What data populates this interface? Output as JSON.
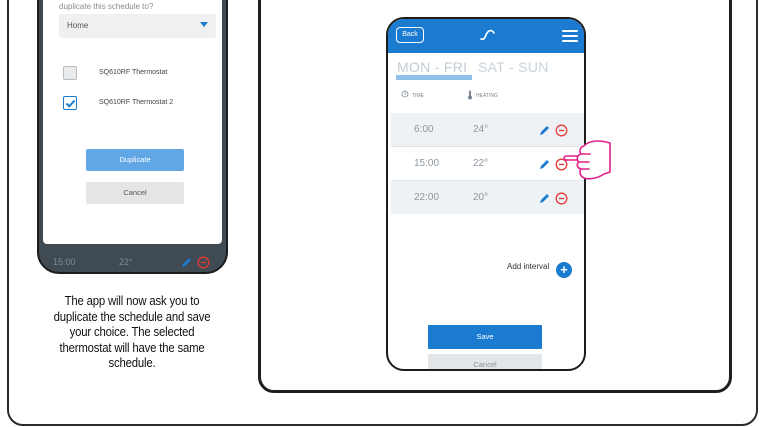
{
  "dialog": {
    "question": "duplicate this schedule to?",
    "select_value": "Home",
    "options": [
      {
        "label": "SQ610RF Thermostat",
        "checked": false
      },
      {
        "label": "SQ610RF Thermostat 2",
        "checked": true
      }
    ],
    "duplicate_label": "Duplicate",
    "cancel_label": "Cancel"
  },
  "left_phone_row": {
    "time": "15:00",
    "temp": "22°"
  },
  "caption": "The app will now ask you to duplicate the schedule and save your choice. The selected thermostat will have the same schedule.",
  "app": {
    "back_label": "Back",
    "tabs": [
      "MON - FRI",
      "SAT - SUN"
    ],
    "columns": {
      "time": "TIME",
      "heating": "HEATING"
    },
    "rows": [
      {
        "time": "6:00",
        "temp": "24°"
      },
      {
        "time": "15:00",
        "temp": "22°"
      },
      {
        "time": "22:00",
        "temp": "20°"
      }
    ],
    "add_interval_label": "Add interval",
    "save_label": "Save",
    "cancel_label": "Cancel"
  },
  "colors": {
    "accent": "#1a7bd0",
    "remove": "#e53935",
    "hand": "#e0218a"
  }
}
